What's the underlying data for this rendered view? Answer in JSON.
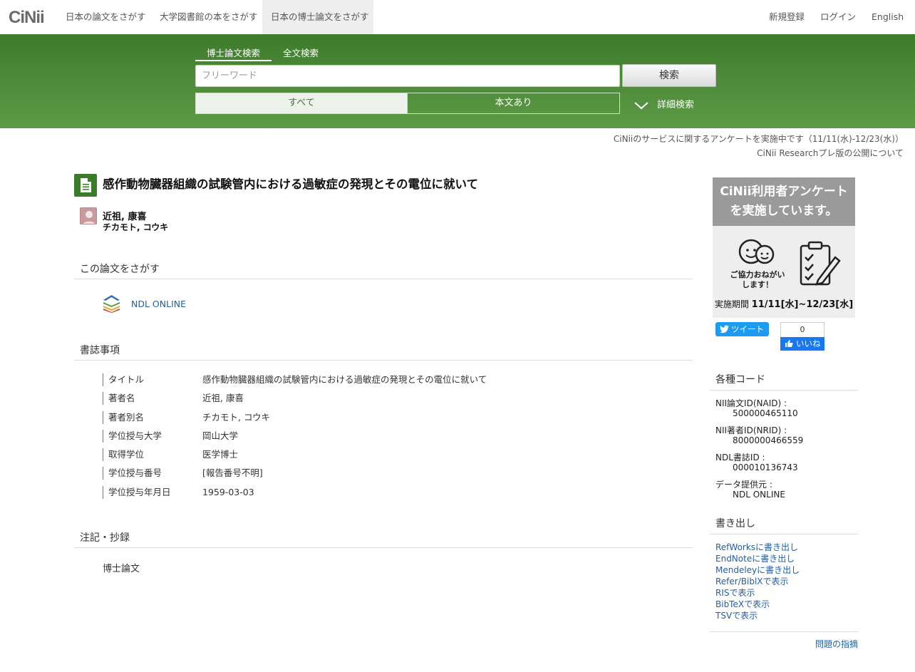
{
  "header": {
    "logo": "CiNii",
    "tabs": [
      "日本の論文をさがす",
      "大学図書館の本をさがす",
      "日本の博士論文をさがす"
    ],
    "right": [
      "新規登録",
      "ログイン",
      "English"
    ]
  },
  "search": {
    "tabs": [
      "博士論文検索",
      "全文検索"
    ],
    "placeholder": "フリーワード",
    "button": "検索",
    "filter_all": "すべて",
    "filter_full": "本文あり",
    "advanced": "詳細検索"
  },
  "notices": [
    "CiNiiのサービスに関するアンケートを実施中です（11/11(水)-12/23(水)）",
    "CiNii Researchプレ版の公開について"
  ],
  "article": {
    "title": "感作動物臓器組織の試験管内における過敏症の発現とその電位に就いて",
    "author": "近祖, 康喜",
    "author_kana": "チカモト, コウキ"
  },
  "find": {
    "heading": "この論文をさがす",
    "link": "NDL ONLINE"
  },
  "bib": {
    "heading": "書誌事項",
    "rows": [
      {
        "key": "タイトル",
        "value": "感作動物臓器組織の試験管内における過敏症の発現とその電位に就いて"
      },
      {
        "key": "著者名",
        "value": "近祖, 康喜"
      },
      {
        "key": "著者別名",
        "value": "チカモト, コウキ"
      },
      {
        "key": "学位授与大学",
        "value": "岡山大学"
      },
      {
        "key": "取得学位",
        "value": "医学博士"
      },
      {
        "key": "学位授与番号",
        "value": "[報告番号不明]"
      },
      {
        "key": "学位授与年月日",
        "value": "1959-03-03"
      }
    ]
  },
  "notes": {
    "heading": "注記・抄録",
    "text": "博士論文"
  },
  "banner": {
    "line1": "CiNii利用者アンケート",
    "line2": "を実施しています。",
    "caption": "ご協力おねがい\nします！",
    "date_label": "実施期間",
    "date_value": "11/11[水]~12/23[水]"
  },
  "social": {
    "tweet": "ツイート",
    "like_count": "0",
    "like": "いいね"
  },
  "codes": {
    "heading": "各種コード",
    "items": [
      {
        "key": "NII論文ID(NAID) :",
        "value": "500000465110"
      },
      {
        "key": "NII著者ID(NRID) :",
        "value": "8000000466559"
      },
      {
        "key": "NDL書誌ID :",
        "value": "000010136743"
      },
      {
        "key": "データ提供元 :",
        "value": "NDL ONLINE"
      }
    ]
  },
  "export": {
    "heading": "書き出し",
    "links": [
      "RefWorksに書き出し",
      "EndNoteに書き出し",
      "Mendeleyに書き出し",
      "Refer/BiblXで表示",
      "RISで表示",
      "BibTeXで表示",
      "TSVで表示"
    ]
  },
  "report": "問題の指摘"
}
